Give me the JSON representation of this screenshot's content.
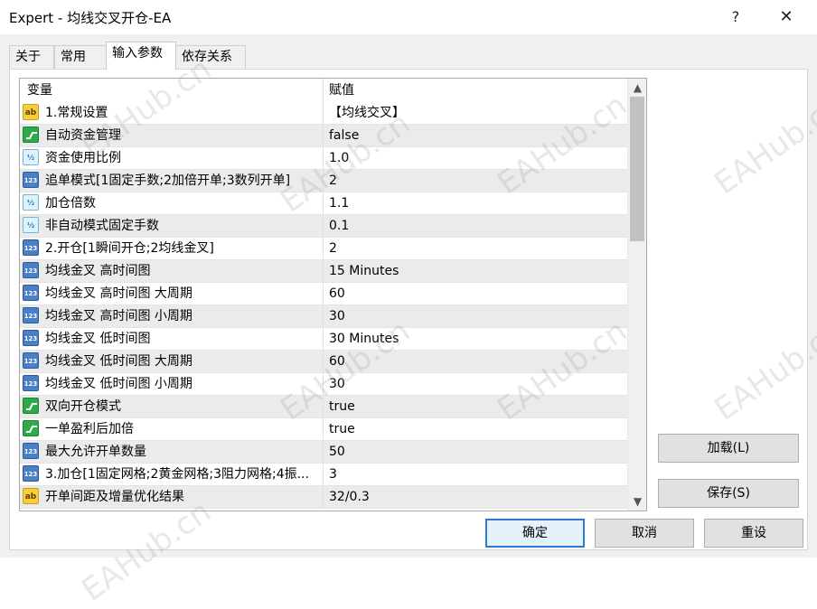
{
  "window": {
    "title": "Expert - 均线交叉开仓-EA",
    "help_label": "?",
    "close_label": "✕"
  },
  "tabs": [
    {
      "label": "关于"
    },
    {
      "label": "常用"
    },
    {
      "label": "输入参数"
    },
    {
      "label": "依存关系"
    }
  ],
  "grid": {
    "col_variable": "变量",
    "col_value": "赋值",
    "rows": [
      {
        "icon": "ab",
        "name": "1.常规设置",
        "value": "【均线交叉】"
      },
      {
        "icon": "bool",
        "name": "自动资金管理",
        "value": "false"
      },
      {
        "icon": "half",
        "name": "资金使用比例",
        "value": "1.0"
      },
      {
        "icon": "123",
        "name": "追单模式[1固定手数;2加倍开单;3数列开单]",
        "value": "2"
      },
      {
        "icon": "half",
        "name": "加仓倍数",
        "value": "1.1"
      },
      {
        "icon": "half",
        "name": "非自动模式固定手数",
        "value": "0.1"
      },
      {
        "icon": "123",
        "name": "2.开仓[1瞬间开仓;2均线金叉]",
        "value": "2"
      },
      {
        "icon": "123",
        "name": "均线金叉 高时间图",
        "value": "15 Minutes"
      },
      {
        "icon": "123",
        "name": "均线金叉 高时间图 大周期",
        "value": "60"
      },
      {
        "icon": "123",
        "name": "均线金叉 高时间图 小周期",
        "value": "30"
      },
      {
        "icon": "123",
        "name": "均线金叉 低时间图",
        "value": "30 Minutes"
      },
      {
        "icon": "123",
        "name": "均线金叉 低时间图 大周期",
        "value": "60"
      },
      {
        "icon": "123",
        "name": "均线金叉 低时间图 小周期",
        "value": "30"
      },
      {
        "icon": "bool",
        "name": "双向开仓模式",
        "value": "true"
      },
      {
        "icon": "bool",
        "name": "一单盈利后加倍",
        "value": "true"
      },
      {
        "icon": "123",
        "name": "最大允许开单数量",
        "value": "50"
      },
      {
        "icon": "123",
        "name": "3.加仓[1固定网格;2黄金网格;3阻力网格;4振...",
        "value": "3"
      },
      {
        "icon": "ab",
        "name": "开单间距及增量优化结果",
        "value": "32/0.3"
      }
    ]
  },
  "icon_text": {
    "ab": "ab",
    "123": "123",
    "half": "½"
  },
  "buttons": {
    "load": "加载(L)",
    "save": "保存(S)",
    "ok": "确定",
    "cancel": "取消",
    "reset": "重设"
  },
  "watermark_text": "EAHub.cn",
  "colors": {
    "selected_button_border": "#2b7bd6",
    "bool_icon": "#2faa4b",
    "int_icon": "#4a7fc6",
    "string_icon": "#f6cd3c"
  }
}
